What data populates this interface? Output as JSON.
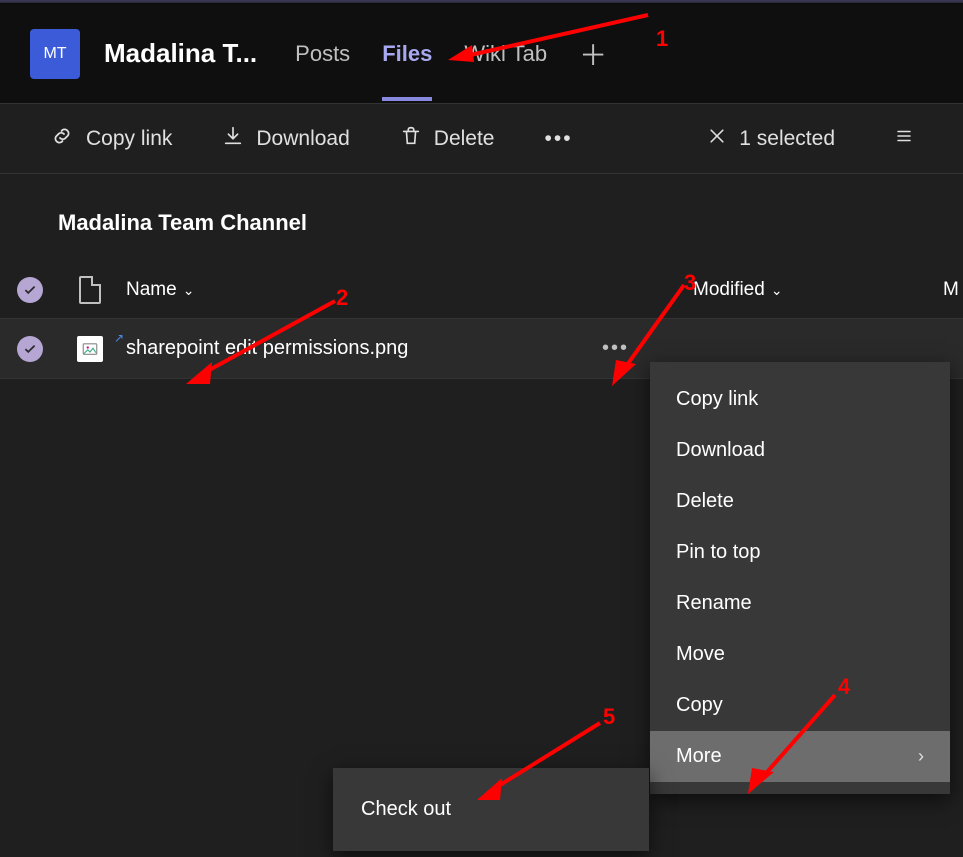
{
  "header": {
    "avatar_initials": "MT",
    "team_name": "Madalina T...",
    "tabs": {
      "posts": "Posts",
      "files": "Files",
      "wiki": "Wiki Tab"
    }
  },
  "toolbar": {
    "copy_link": "Copy link",
    "download": "Download",
    "delete": "Delete",
    "selected": "1 selected"
  },
  "channel": {
    "title": "Madalina Team Channel"
  },
  "columns": {
    "name": "Name",
    "modified": "Modified",
    "modified_by_initial": "M"
  },
  "file": {
    "name": "sharepoint edit permissions.png"
  },
  "context_menu": {
    "copy_link": "Copy link",
    "download": "Download",
    "delete": "Delete",
    "pin_to_top": "Pin to top",
    "rename": "Rename",
    "move": "Move",
    "copy": "Copy",
    "more": "More"
  },
  "submenu": {
    "check_out": "Check out"
  },
  "annotations": {
    "a1": "1",
    "a2": "2",
    "a3": "3",
    "a4": "4",
    "a5": "5"
  }
}
